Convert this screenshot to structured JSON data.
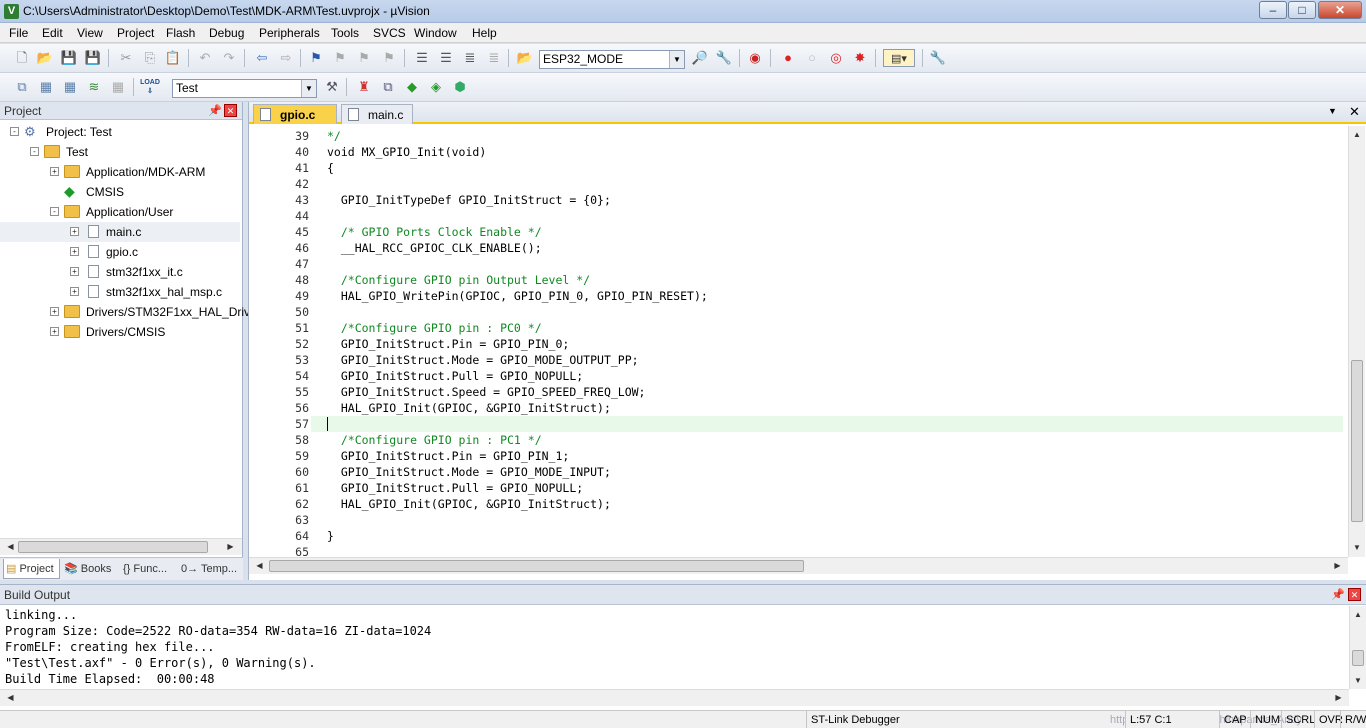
{
  "window": {
    "title": "C:\\Users\\Administrator\\Desktop\\Demo\\Test\\MDK-ARM\\Test.uvprojx - µVision",
    "app_icon": "V",
    "minimize": "–",
    "maximize": "□",
    "close": "✕"
  },
  "menu": [
    "File",
    "Edit",
    "View",
    "Project",
    "Flash",
    "Debug",
    "Peripherals",
    "Tools",
    "SVCS",
    "Window",
    "Help"
  ],
  "toolbar1": {
    "target_combo": "ESP32_MODE"
  },
  "toolbar2": {
    "load_label": "LOAD",
    "target_combo": "Test"
  },
  "project_panel": {
    "title": "Project",
    "tree": [
      {
        "label": "Project: Test",
        "level": 0,
        "expander": "-",
        "icon": "project"
      },
      {
        "label": "Test",
        "level": 1,
        "expander": "-",
        "icon": "folder-open"
      },
      {
        "label": "Application/MDK-ARM",
        "level": 2,
        "expander": "+",
        "icon": "folder"
      },
      {
        "label": "CMSIS",
        "level": 2,
        "expander": "",
        "icon": "cmsis"
      },
      {
        "label": "Application/User",
        "level": 2,
        "expander": "-",
        "icon": "folder-open"
      },
      {
        "label": "main.c",
        "level": 3,
        "expander": "+",
        "icon": "file",
        "selected": true
      },
      {
        "label": "gpio.c",
        "level": 3,
        "expander": "+",
        "icon": "file"
      },
      {
        "label": "stm32f1xx_it.c",
        "level": 3,
        "expander": "+",
        "icon": "file"
      },
      {
        "label": "stm32f1xx_hal_msp.c",
        "level": 3,
        "expander": "+",
        "icon": "file"
      },
      {
        "label": "Drivers/STM32F1xx_HAL_Driv",
        "level": 2,
        "expander": "+",
        "icon": "folder"
      },
      {
        "label": "Drivers/CMSIS",
        "level": 2,
        "expander": "+",
        "icon": "folder"
      }
    ],
    "tabs": [
      "Project",
      "Books",
      "{} Func...",
      "0→ Temp..."
    ]
  },
  "editor": {
    "tabs": [
      {
        "label": "gpio.c",
        "active": true
      },
      {
        "label": "main.c",
        "active": false
      }
    ],
    "lines": [
      {
        "n": "39",
        "text": "*/",
        "type": "cmt",
        "fold": ""
      },
      {
        "n": "40",
        "text": "void MX_GPIO_Init(void)",
        "type": "code",
        "fold": ""
      },
      {
        "n": "41",
        "text": "{",
        "type": "code",
        "fold": "-"
      },
      {
        "n": "42",
        "text": "",
        "type": "code",
        "fold": ""
      },
      {
        "n": "43",
        "text": "  GPIO_InitTypeDef GPIO_InitStruct = {0};",
        "type": "code",
        "fold": ""
      },
      {
        "n": "44",
        "text": "",
        "type": "code",
        "fold": ""
      },
      {
        "n": "45",
        "text": "  /* GPIO Ports Clock Enable */",
        "type": "cmt",
        "fold": ""
      },
      {
        "n": "46",
        "text": "  __HAL_RCC_GPIOC_CLK_ENABLE();",
        "type": "code",
        "fold": ""
      },
      {
        "n": "47",
        "text": "",
        "type": "code",
        "fold": ""
      },
      {
        "n": "48",
        "text": "  /*Configure GPIO pin Output Level */",
        "type": "cmt",
        "fold": ""
      },
      {
        "n": "49",
        "text": "  HAL_GPIO_WritePin(GPIOC, GPIO_PIN_0, GPIO_PIN_RESET);",
        "type": "code",
        "fold": ""
      },
      {
        "n": "50",
        "text": "",
        "type": "code",
        "fold": ""
      },
      {
        "n": "51",
        "text": "  /*Configure GPIO pin : PC0 */",
        "type": "cmt",
        "fold": ""
      },
      {
        "n": "52",
        "text": "  GPIO_InitStruct.Pin = GPIO_PIN_0;",
        "type": "code",
        "fold": ""
      },
      {
        "n": "53",
        "text": "  GPIO_InitStruct.Mode = GPIO_MODE_OUTPUT_PP;",
        "type": "code",
        "fold": ""
      },
      {
        "n": "54",
        "text": "  GPIO_InitStruct.Pull = GPIO_NOPULL;",
        "type": "code",
        "fold": ""
      },
      {
        "n": "55",
        "text": "  GPIO_InitStruct.Speed = GPIO_SPEED_FREQ_LOW;",
        "type": "code",
        "fold": ""
      },
      {
        "n": "56",
        "text": "  HAL_GPIO_Init(GPIOC, &GPIO_InitStruct);",
        "type": "code",
        "fold": ""
      },
      {
        "n": "57",
        "text": "",
        "type": "code",
        "fold": "",
        "current": true
      },
      {
        "n": "58",
        "text": "  /*Configure GPIO pin : PC1 */",
        "type": "cmt",
        "fold": ""
      },
      {
        "n": "59",
        "text": "  GPIO_InitStruct.Pin = GPIO_PIN_1;",
        "type": "code",
        "fold": ""
      },
      {
        "n": "60",
        "text": "  GPIO_InitStruct.Mode = GPIO_MODE_INPUT;",
        "type": "code",
        "fold": ""
      },
      {
        "n": "61",
        "text": "  GPIO_InitStruct.Pull = GPIO_NOPULL;",
        "type": "code",
        "fold": ""
      },
      {
        "n": "62",
        "text": "  HAL_GPIO_Init(GPIOC, &GPIO_InitStruct);",
        "type": "code",
        "fold": ""
      },
      {
        "n": "63",
        "text": "",
        "type": "code",
        "fold": ""
      },
      {
        "n": "64",
        "text": "}",
        "type": "code",
        "fold": ""
      },
      {
        "n": "65",
        "text": "",
        "type": "code",
        "fold": ""
      }
    ]
  },
  "build_output": {
    "title": "Build Output",
    "lines": [
      "linking...",
      "Program Size: Code=2522 RO-data=354 RW-data=16 ZI-data=1024",
      "FromELF: creating hex file...",
      "\"Test\\Test.axf\" - 0 Error(s), 0 Warning(s).",
      "Build Time Elapsed:  00:00:48"
    ]
  },
  "status": {
    "debugger": "ST-Link Debugger",
    "position": "L:57 C:1",
    "caps": "CAP",
    "num": "NUM",
    "scrl": "SCRL",
    "ovr": "OVR",
    "rw": "R/W",
    "watermark": "https://blog.csdn.net/Chinapanda_Andy"
  },
  "colors": {
    "comment": "#0f8a21",
    "active_tab": "#f9d24a",
    "current_line": "#e9f9e9"
  }
}
